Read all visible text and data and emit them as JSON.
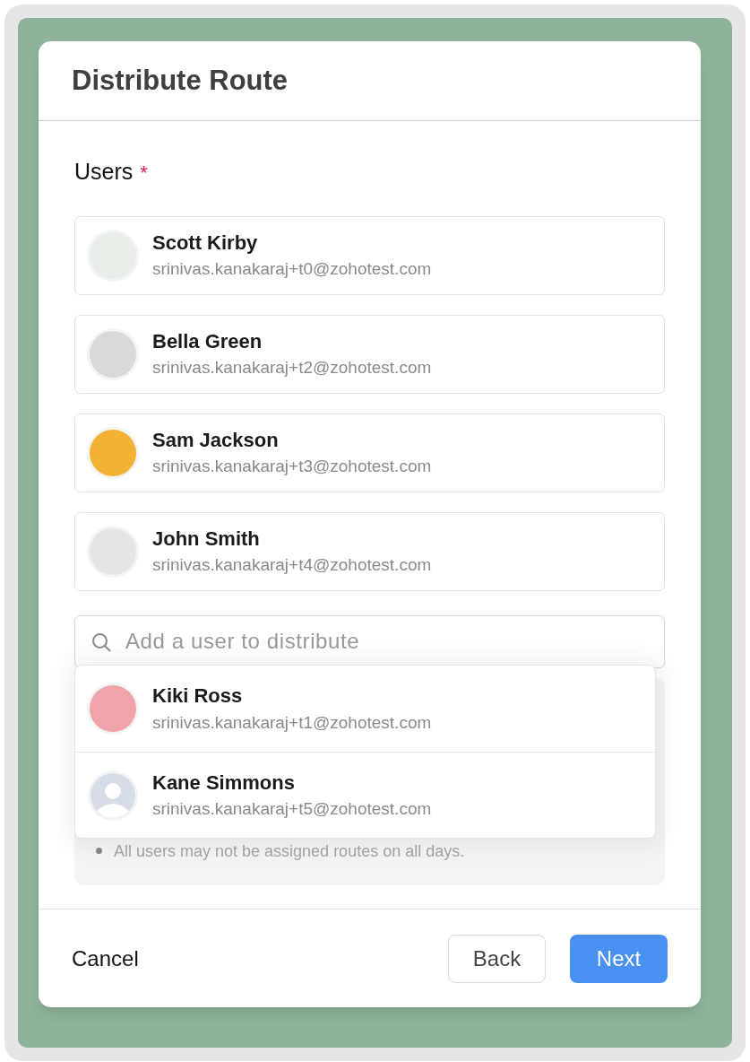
{
  "dialog": {
    "title": "Distribute Route"
  },
  "users_label": {
    "text": "Users",
    "required_mark": "*"
  },
  "selected_users": [
    {
      "name": "Scott Kirby",
      "email": "srinivas.kanakaraj+t0@zohotest.com",
      "kind": "photo",
      "color": "#e8efe9"
    },
    {
      "name": "Bella Green",
      "email": "srinivas.kanakaraj+t2@zohotest.com",
      "kind": "photo",
      "color": "#d9d9d9"
    },
    {
      "name": "Sam Jackson",
      "email": "srinivas.kanakaraj+t3@zohotest.com",
      "kind": "photo",
      "color": "#f2b233"
    },
    {
      "name": "John Smith",
      "email": "srinivas.kanakaraj+t4@zohotest.com",
      "kind": "photo",
      "color": "#e6e6e6"
    }
  ],
  "search": {
    "placeholder": "Add a user to distribute"
  },
  "suggestions": [
    {
      "name": "Kiki Ross",
      "email": "srinivas.kanakaraj+t1@zohotest.com",
      "kind": "photo",
      "color": "#f0a3a8"
    },
    {
      "name": "Kane Simmons",
      "email": "srinivas.kanakaraj+t5@zohotest.com",
      "kind": "silhouette",
      "color": "#d6dde9"
    }
  ],
  "note": {
    "text": "All users may not be assigned routes on all days."
  },
  "footer": {
    "cancel": "Cancel",
    "back": "Back",
    "next": "Next"
  }
}
